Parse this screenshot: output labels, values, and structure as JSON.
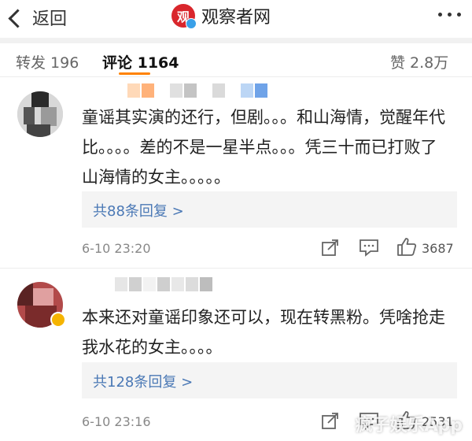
{
  "header": {
    "back_label": "返回",
    "logo_glyph": "观",
    "title": "观察者网"
  },
  "tabs": {
    "repost": "转发 196",
    "comments": "评论 1164",
    "likes": "赞 2.8万"
  },
  "comments": [
    {
      "text": "童谣其实演的还行，但剧。。。和山海情，觉醒年代比。。。。差的不是一星半点。。。凭三十而已打败了山海情的女主。。。。。",
      "replies": "共88条回复 >",
      "time": "6-10 23:20",
      "likes": "3687"
    },
    {
      "text": "本来还对童谣印象还可以，现在转黑粉。凭啥抢走我水花的女主。。。。",
      "replies": "共128条回复 >",
      "time": "6-10 23:16",
      "likes": "2531"
    }
  ],
  "watermark": "疯子娱乐App",
  "colors": {
    "accent": "#ff8200",
    "link": "#4a78b5",
    "brand_red": "#d9262c"
  }
}
